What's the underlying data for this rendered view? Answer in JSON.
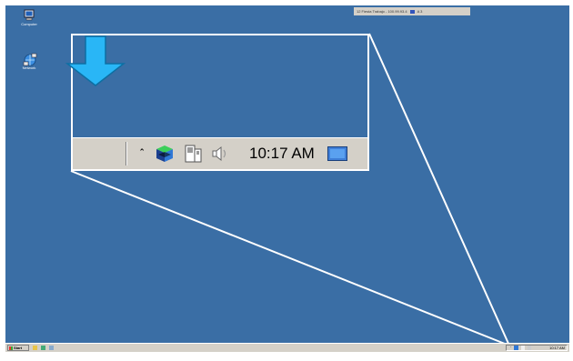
{
  "desktop": {
    "background": "#3a6ea5",
    "icons": [
      {
        "name": "my-computer",
        "label": "Computer",
        "icon": "computer-icon"
      },
      {
        "name": "network",
        "label": "Network",
        "icon": "network-icon"
      }
    ]
  },
  "top_bar": {
    "text": "12 Fiesta Trabajo - 100.99.93.4",
    "tab": "A 3"
  },
  "callout": {
    "clock": "10:17 AM",
    "arrow_color": "#29b6f6",
    "tray_icons": [
      "chevron-up-icon",
      "app-cube-icon",
      "network-icon",
      "speaker-icon",
      "desktop-icon"
    ]
  },
  "taskbar": {
    "start_label": "Start",
    "clock": "10:17 AM"
  }
}
